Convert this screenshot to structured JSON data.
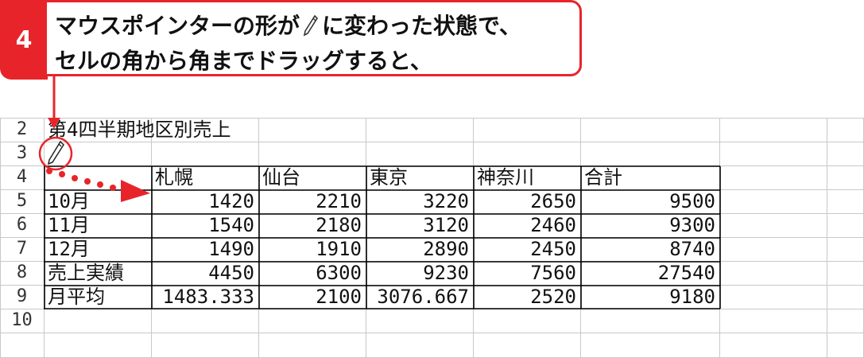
{
  "step": {
    "number": "4",
    "line1_before": "マウスポインターの形が",
    "line1_after": "に変わった状態で、",
    "line2": "セルの角から角までドラッグすると、"
  },
  "icons": {
    "pointer": "pencil-icon"
  },
  "colors": {
    "accent": "#e8242b",
    "grid": "#c8c8c8",
    "border": "#000000"
  },
  "sheet": {
    "rows": [
      {
        "num": "2",
        "cells": [
          "第4四半期地区別売上",
          "",
          "",
          "",
          "",
          ""
        ]
      },
      {
        "num": "3",
        "cells": [
          "",
          "",
          "",
          "",
          "",
          ""
        ]
      },
      {
        "num": "4",
        "cells": [
          "",
          "札幌",
          "仙台",
          "東京",
          "神奈川",
          "合計"
        ]
      },
      {
        "num": "5",
        "cells": [
          "10月",
          "1420",
          "2210",
          "3220",
          "2650",
          "9500"
        ]
      },
      {
        "num": "6",
        "cells": [
          "11月",
          "1540",
          "2180",
          "3120",
          "2460",
          "9300"
        ]
      },
      {
        "num": "7",
        "cells": [
          "12月",
          "1490",
          "1910",
          "2890",
          "2450",
          "8740"
        ]
      },
      {
        "num": "8",
        "cells": [
          "売上実績",
          "4450",
          "6300",
          "9230",
          "7560",
          "27540"
        ]
      },
      {
        "num": "9",
        "cells": [
          "月平均",
          "1483.333",
          "2100",
          "3076.667",
          "2520",
          "9180"
        ]
      },
      {
        "num": "10",
        "cells": [
          "",
          "",
          "",
          "",
          "",
          ""
        ]
      }
    ]
  }
}
